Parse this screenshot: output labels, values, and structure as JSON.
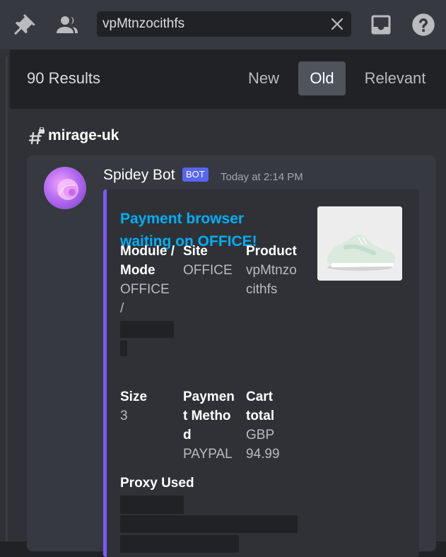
{
  "toolbar": {
    "pin_icon": "pin-icon",
    "members_icon": "members-icon",
    "search_value": "vpMtnzocithfs",
    "clear_icon": "close-icon",
    "inbox_icon": "inbox-icon",
    "help_icon": "help-icon"
  },
  "results": {
    "count_label": "90 Results",
    "sort_options": [
      "New",
      "Old",
      "Relevant"
    ],
    "active_sort": "Old"
  },
  "channel": {
    "name": "mirage-uk",
    "icon": "locked-channel-hash-icon"
  },
  "message": {
    "author": "Spidey Bot",
    "tag": "BOT",
    "timestamp": "Today at 2:14 PM",
    "embed": {
      "accent_color": "#7b5cff",
      "title": "Payment browser waiting on OFFICE!",
      "thumbnail": "sneaker-thumbnail",
      "fields": {
        "module": {
          "name": "Module / Mode",
          "value": "OFFICE /"
        },
        "site": {
          "name": "Site",
          "value": "OFFICE"
        },
        "product": {
          "name": "Product",
          "value": "vpMtnzocithfs"
        },
        "size": {
          "name": "Size",
          "value": "3"
        },
        "payment": {
          "name": "Payment Method",
          "value": "PAYPAL"
        },
        "cart": {
          "name": "Cart total",
          "value": "GBP 94.99"
        },
        "proxy": {
          "name": "Proxy Used",
          "value": ""
        }
      }
    }
  },
  "colors": {
    "app_bg": "#202225",
    "panel_bg": "#2f3136",
    "card_bg": "#36393f",
    "link": "#00aff4",
    "bot_tag": "#5865f2"
  }
}
